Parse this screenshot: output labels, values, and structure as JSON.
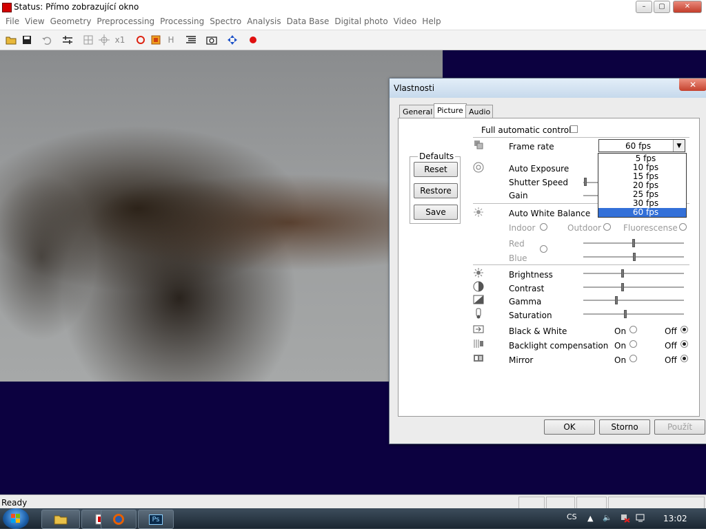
{
  "window": {
    "title": "Status: Přímo zobrazující okno",
    "min": "–",
    "max": "▢",
    "close": "✕"
  },
  "menu": [
    "File",
    "View",
    "Geometry",
    "Preprocessing",
    "Processing",
    "Spectro",
    "Analysis",
    "Data Base",
    "Digital photo",
    "Video",
    "Help"
  ],
  "toolbar_icons": [
    "open-folder-icon",
    "save-icon",
    "undo-icon",
    "adjust-icon",
    "zoom-fit-icon",
    "crosshair-icon",
    "x1-zoom-icon",
    "refresh-icon",
    "frame-icon",
    "histogram-icon",
    "list-icon",
    "camera-icon",
    "move-icon",
    "record-icon"
  ],
  "toolbar_text": {
    "x1": "x1",
    "h": "H"
  },
  "status": {
    "text": "Ready"
  },
  "taskbar": {
    "lang": "CS",
    "clock": "13:02",
    "ps_label": "Ps"
  },
  "dialog": {
    "title": "Vlastnosti",
    "close": "✕",
    "tabs": [
      "General",
      "Picture",
      "Audio"
    ],
    "active_tab": "Picture",
    "full_auto": "Full automatic control",
    "defaults": {
      "label": "Defaults",
      "reset": "Reset",
      "restore": "Restore",
      "save": "Save"
    },
    "frame_rate": {
      "label": "Frame rate",
      "value": "60 fps",
      "options": [
        "5 fps",
        "10 fps",
        "15 fps",
        "20 fps",
        "25 fps",
        "30 fps",
        "60 fps"
      ],
      "selected": "60 fps"
    },
    "auto_exposure": "Auto Exposure",
    "shutter_speed": "Shutter Speed",
    "gain": "Gain",
    "awb": "Auto White Balance",
    "wb_modes": {
      "indoor": "Indoor",
      "outdoor": "Outdoor",
      "fluorescent": "Fluorescense"
    },
    "red": "Red",
    "blue": "Blue",
    "sliders": {
      "red": 0.5,
      "blue": 0.51,
      "brightness": 0.39,
      "contrast": 0.39,
      "gamma": 0.33,
      "saturation": 0.42,
      "shutter": 0.02
    },
    "brightness": "Brightness",
    "contrast": "Contrast",
    "gamma": "Gamma",
    "saturation": "Saturation",
    "bw": {
      "label": "Black & White",
      "on": "On",
      "off": "Off",
      "value": "Off"
    },
    "backlight": {
      "label": "Backlight compensation",
      "on": "On",
      "off": "Off",
      "value": "Off"
    },
    "mirror": {
      "label": "Mirror",
      "on": "On",
      "off": "Off",
      "value": "Off"
    },
    "ok": "OK",
    "cancel": "Storno",
    "apply": "Použít"
  }
}
